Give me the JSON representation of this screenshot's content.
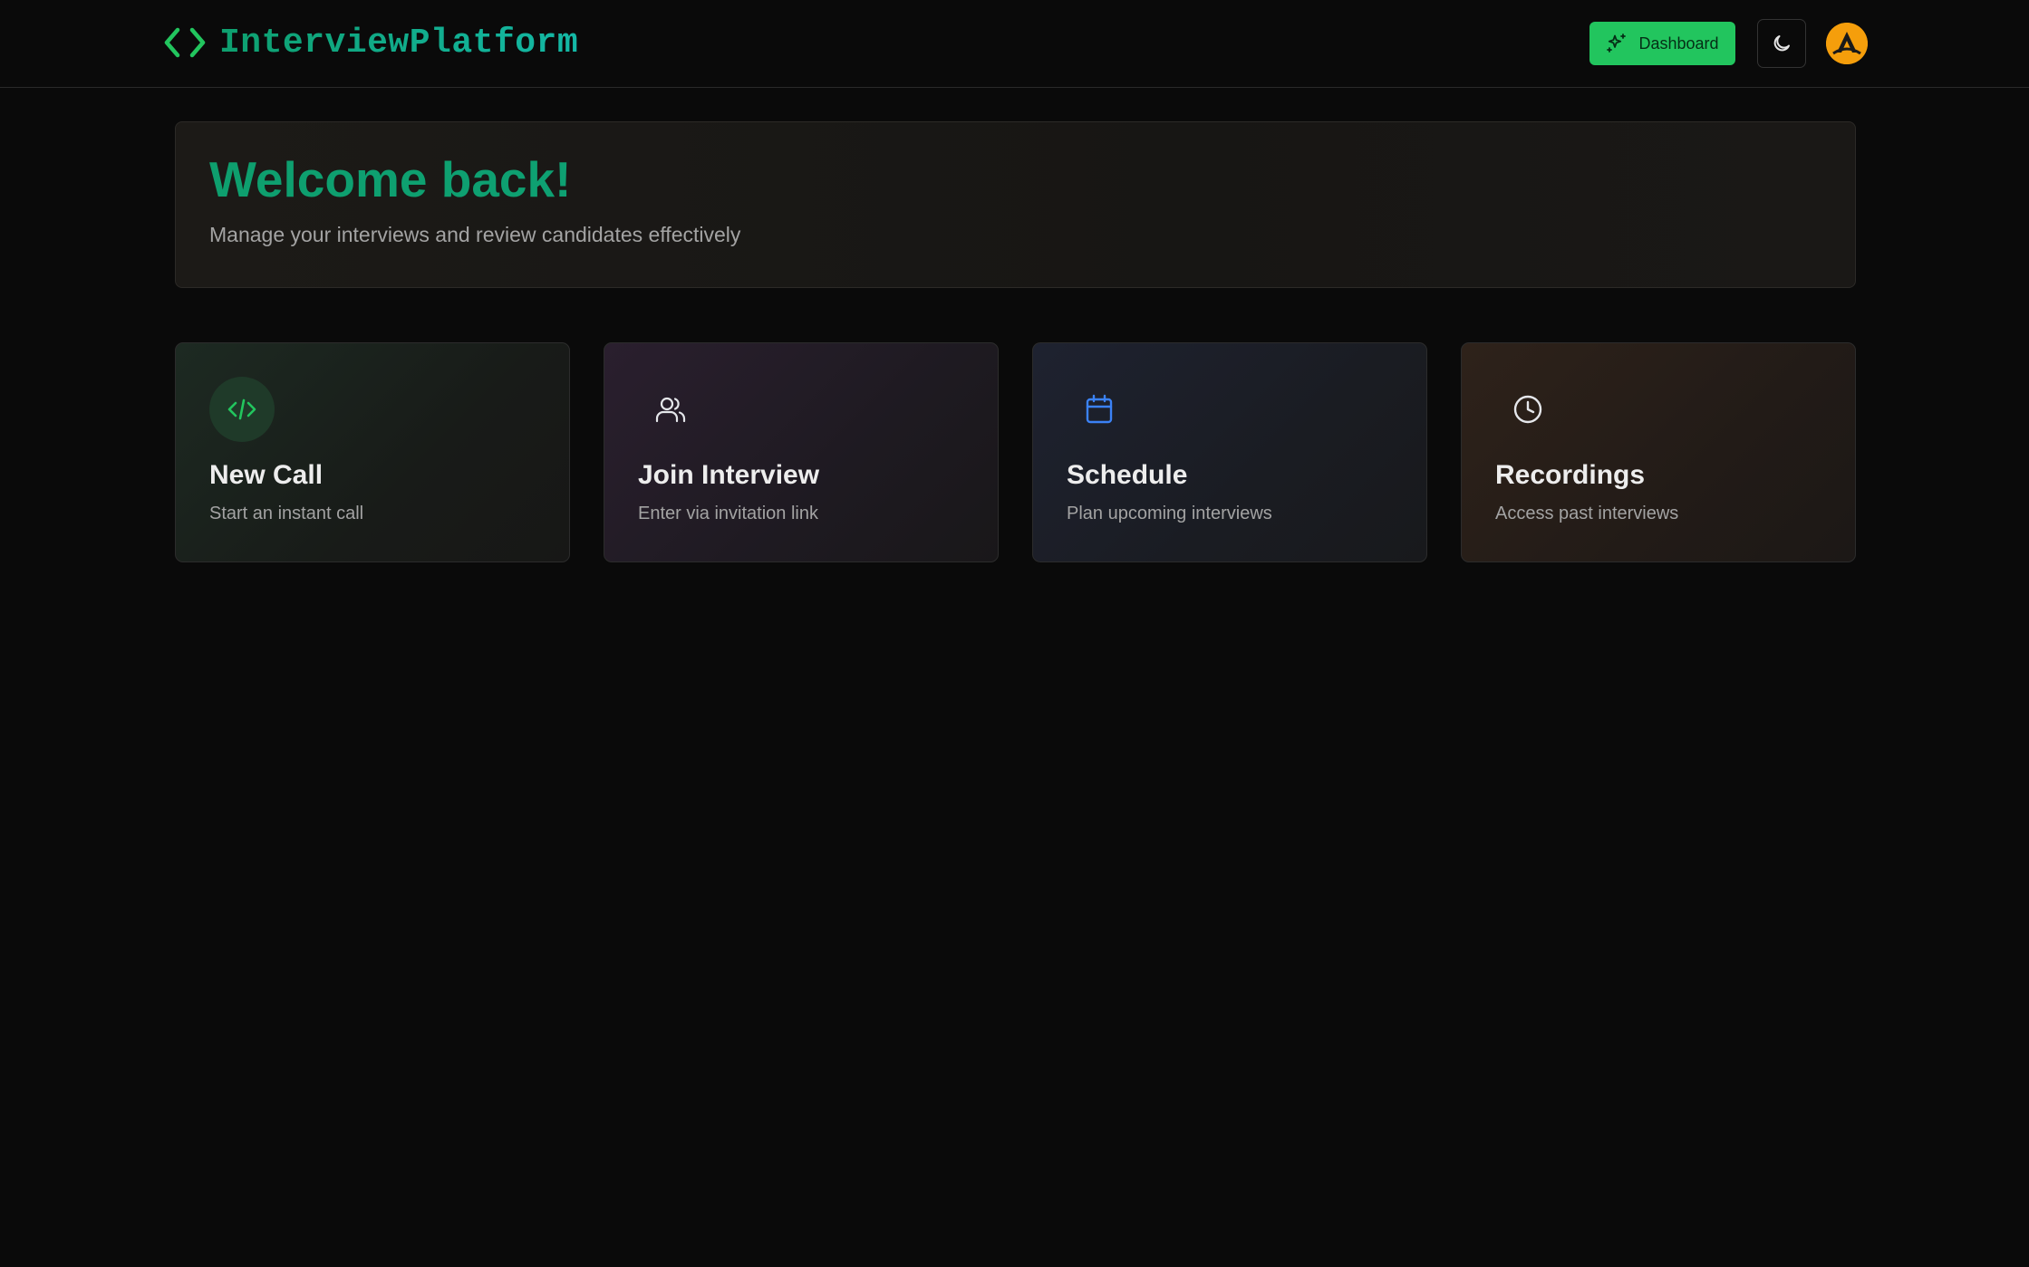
{
  "header": {
    "brand": "InterviewPlatform",
    "dashboard_label": "Dashboard"
  },
  "welcome": {
    "title": "Welcome back!",
    "subtitle": "Manage your interviews and review candidates effectively"
  },
  "cards": [
    {
      "title": "New Call",
      "description": "Start an instant call",
      "icon": "code-icon",
      "accent": "#22c55e"
    },
    {
      "title": "Join Interview",
      "description": "Enter via invitation link",
      "icon": "users-icon",
      "accent": "#e5e7eb"
    },
    {
      "title": "Schedule",
      "description": "Plan upcoming interviews",
      "icon": "calendar-icon",
      "accent": "#3b82f6"
    },
    {
      "title": "Recordings",
      "description": "Access past interviews",
      "icon": "clock-icon",
      "accent": "#e5e7eb"
    }
  ],
  "colors": {
    "brand": "#10a37f",
    "primary_button": "#22c55e",
    "avatar": "#f59e0b",
    "background": "#0a0a0a"
  }
}
